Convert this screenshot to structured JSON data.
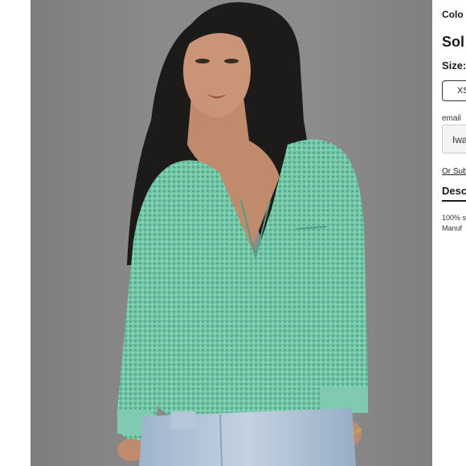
{
  "product_panel": {
    "color_label": "Colo",
    "title": "Sol",
    "size_label": "Size:",
    "size_option": "XS",
    "email_label": "email",
    "email_value": "Iwa",
    "subscribe_link": "Or Sub",
    "description_tab": "Desc",
    "description_line1": "100% s",
    "description_line2": "Manuf"
  }
}
